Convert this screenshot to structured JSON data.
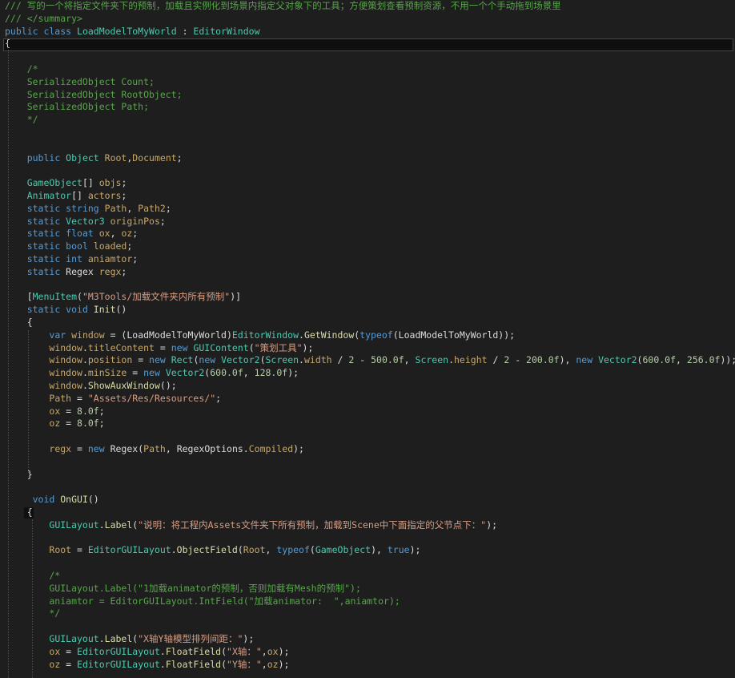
{
  "editor": {
    "colors": {
      "background": "#1e1e1e",
      "comment": "#57a64a",
      "keyword": "#569cd6",
      "type": "#4ec9b0",
      "string": "#d69d85",
      "number": "#b5cea8",
      "identifier": "#dcdcdc",
      "field": "#c8a86b",
      "method": "#dcdcaa"
    },
    "lines": [
      [
        [
          "comment",
          "/// 写的一个将指定文件夹下的预制，加载且实例化到场景内指定父对象下的工具；方便策划查看预制资源，不用一个个手动拖到场景里"
        ]
      ],
      [
        [
          "comment",
          "/// </summary>"
        ]
      ],
      [
        [
          "keyword",
          "public class "
        ],
        [
          "type",
          "LoadModelToMyWorld"
        ],
        [
          "punct",
          " : "
        ],
        [
          "type",
          "EditorWindow"
        ]
      ],
      [
        [
          "punct",
          "{"
        ]
      ],
      [],
      [
        [
          "comment",
          "    /*"
        ]
      ],
      [
        [
          "comment",
          "    SerializedObject Count;"
        ]
      ],
      [
        [
          "comment",
          "    SerializedObject RootObject;"
        ]
      ],
      [
        [
          "comment",
          "    SerializedObject Path;"
        ]
      ],
      [
        [
          "comment",
          "    */"
        ]
      ],
      [],
      [],
      [
        [
          "punct",
          "    "
        ],
        [
          "keyword",
          "public "
        ],
        [
          "type",
          "Object "
        ],
        [
          "field",
          "Root"
        ],
        [
          "punct",
          ","
        ],
        [
          "field",
          "Document"
        ],
        [
          "punct",
          ";"
        ]
      ],
      [],
      [
        [
          "punct",
          "    "
        ],
        [
          "type",
          "GameObject"
        ],
        [
          "punct",
          "[] "
        ],
        [
          "field",
          "objs"
        ],
        [
          "punct",
          ";"
        ]
      ],
      [
        [
          "punct",
          "    "
        ],
        [
          "type",
          "Animator"
        ],
        [
          "punct",
          "[] "
        ],
        [
          "field",
          "actors"
        ],
        [
          "punct",
          ";"
        ]
      ],
      [
        [
          "punct",
          "    "
        ],
        [
          "keyword",
          "static string "
        ],
        [
          "field",
          "Path"
        ],
        [
          "punct",
          ", "
        ],
        [
          "field",
          "Path2"
        ],
        [
          "punct",
          ";"
        ]
      ],
      [
        [
          "punct",
          "    "
        ],
        [
          "keyword",
          "static "
        ],
        [
          "type",
          "Vector3 "
        ],
        [
          "field",
          "originPos"
        ],
        [
          "punct",
          ";"
        ]
      ],
      [
        [
          "punct",
          "    "
        ],
        [
          "keyword",
          "static float "
        ],
        [
          "field",
          "ox"
        ],
        [
          "punct",
          ", "
        ],
        [
          "field",
          "oz"
        ],
        [
          "punct",
          ";"
        ]
      ],
      [
        [
          "punct",
          "    "
        ],
        [
          "keyword",
          "static bool "
        ],
        [
          "field",
          "loaded"
        ],
        [
          "punct",
          ";"
        ]
      ],
      [
        [
          "punct",
          "    "
        ],
        [
          "keyword",
          "static int "
        ],
        [
          "field",
          "aniamtor"
        ],
        [
          "punct",
          ";"
        ]
      ],
      [
        [
          "punct",
          "    "
        ],
        [
          "keyword",
          "static "
        ],
        [
          "ident",
          "Regex "
        ],
        [
          "field",
          "regx"
        ],
        [
          "punct",
          ";"
        ]
      ],
      [],
      [
        [
          "punct",
          "    ["
        ],
        [
          "type",
          "MenuItem"
        ],
        [
          "punct",
          "("
        ],
        [
          "string",
          "\"M3Tools/加载文件夹内所有预制\""
        ],
        [
          "punct",
          ")]"
        ]
      ],
      [
        [
          "punct",
          "    "
        ],
        [
          "keyword",
          "static void "
        ],
        [
          "method",
          "Init"
        ],
        [
          "punct",
          "()"
        ]
      ],
      [
        [
          "punct",
          "    {"
        ]
      ],
      [
        [
          "punct",
          "        "
        ],
        [
          "keyword",
          "var "
        ],
        [
          "field",
          "window"
        ],
        [
          "punct",
          " = ("
        ],
        [
          "ident",
          "LoadModelToMyWorld"
        ],
        [
          "punct",
          ")"
        ],
        [
          "type",
          "EditorWindow"
        ],
        [
          "punct",
          "."
        ],
        [
          "method",
          "GetWindow"
        ],
        [
          "punct",
          "("
        ],
        [
          "keyword",
          "typeof"
        ],
        [
          "punct",
          "("
        ],
        [
          "ident",
          "LoadModelToMyWorld"
        ],
        [
          "punct",
          "));"
        ]
      ],
      [
        [
          "punct",
          "        "
        ],
        [
          "field",
          "window"
        ],
        [
          "punct",
          "."
        ],
        [
          "field",
          "titleContent"
        ],
        [
          "punct",
          " = "
        ],
        [
          "keyword",
          "new "
        ],
        [
          "type",
          "GUIContent"
        ],
        [
          "punct",
          "("
        ],
        [
          "string",
          "\"策划工具\""
        ],
        [
          "punct",
          ");"
        ]
      ],
      [
        [
          "punct",
          "        "
        ],
        [
          "field",
          "window"
        ],
        [
          "punct",
          "."
        ],
        [
          "field",
          "position"
        ],
        [
          "punct",
          " = "
        ],
        [
          "keyword",
          "new "
        ],
        [
          "type",
          "Rect"
        ],
        [
          "punct",
          "("
        ],
        [
          "keyword",
          "new "
        ],
        [
          "type",
          "Vector2"
        ],
        [
          "punct",
          "("
        ],
        [
          "type",
          "Screen"
        ],
        [
          "punct",
          "."
        ],
        [
          "field",
          "width"
        ],
        [
          "punct",
          " / "
        ],
        [
          "number",
          "2"
        ],
        [
          "punct",
          " - "
        ],
        [
          "number",
          "500.0f"
        ],
        [
          "punct",
          ", "
        ],
        [
          "type",
          "Screen"
        ],
        [
          "punct",
          "."
        ],
        [
          "field",
          "height"
        ],
        [
          "punct",
          " / "
        ],
        [
          "number",
          "2"
        ],
        [
          "punct",
          " - "
        ],
        [
          "number",
          "200.0f"
        ],
        [
          "punct",
          "), "
        ],
        [
          "keyword",
          "new "
        ],
        [
          "type",
          "Vector2"
        ],
        [
          "punct",
          "("
        ],
        [
          "number",
          "600.0f"
        ],
        [
          "punct",
          ", "
        ],
        [
          "number",
          "256.0f"
        ],
        [
          "punct",
          "));"
        ]
      ],
      [
        [
          "punct",
          "        "
        ],
        [
          "field",
          "window"
        ],
        [
          "punct",
          "."
        ],
        [
          "field",
          "minSize"
        ],
        [
          "punct",
          " = "
        ],
        [
          "keyword",
          "new "
        ],
        [
          "type",
          "Vector2"
        ],
        [
          "punct",
          "("
        ],
        [
          "number",
          "600.0f"
        ],
        [
          "punct",
          ", "
        ],
        [
          "number",
          "128.0f"
        ],
        [
          "punct",
          ");"
        ]
      ],
      [
        [
          "punct",
          "        "
        ],
        [
          "field",
          "window"
        ],
        [
          "punct",
          "."
        ],
        [
          "method",
          "ShowAuxWindow"
        ],
        [
          "punct",
          "();"
        ]
      ],
      [
        [
          "punct",
          "        "
        ],
        [
          "field",
          "Path"
        ],
        [
          "punct",
          " = "
        ],
        [
          "string",
          "\"Assets/Res/Resources/\""
        ],
        [
          "punct",
          ";"
        ]
      ],
      [
        [
          "punct",
          "        "
        ],
        [
          "field",
          "ox"
        ],
        [
          "punct",
          " = "
        ],
        [
          "number",
          "8.0f"
        ],
        [
          "punct",
          ";"
        ]
      ],
      [
        [
          "punct",
          "        "
        ],
        [
          "field",
          "oz"
        ],
        [
          "punct",
          " = "
        ],
        [
          "number",
          "8.0f"
        ],
        [
          "punct",
          ";"
        ]
      ],
      [],
      [
        [
          "punct",
          "        "
        ],
        [
          "field",
          "regx"
        ],
        [
          "punct",
          " = "
        ],
        [
          "keyword",
          "new "
        ],
        [
          "ident",
          "Regex"
        ],
        [
          "punct",
          "("
        ],
        [
          "field",
          "Path"
        ],
        [
          "punct",
          ", "
        ],
        [
          "ident",
          "RegexOptions"
        ],
        [
          "punct",
          "."
        ],
        [
          "field",
          "Compiled"
        ],
        [
          "punct",
          ");"
        ]
      ],
      [],
      [
        [
          "punct",
          "    }"
        ]
      ],
      [],
      [
        [
          "punct",
          "     "
        ],
        [
          "keyword",
          "void "
        ],
        [
          "method",
          "OnGUI"
        ],
        [
          "punct",
          "()"
        ]
      ],
      [
        [
          "punct",
          "    {"
        ]
      ],
      [
        [
          "punct",
          "        "
        ],
        [
          "type",
          "GUILayout"
        ],
        [
          "punct",
          "."
        ],
        [
          "method",
          "Label"
        ],
        [
          "punct",
          "("
        ],
        [
          "string",
          "\"说明：将工程内Assets文件夹下所有预制，加载到Scene中下面指定的父节点下：\""
        ],
        [
          "punct",
          ");"
        ]
      ],
      [],
      [
        [
          "punct",
          "        "
        ],
        [
          "field",
          "Root"
        ],
        [
          "punct",
          " = "
        ],
        [
          "type",
          "EditorGUILayout"
        ],
        [
          "punct",
          "."
        ],
        [
          "method",
          "ObjectField"
        ],
        [
          "punct",
          "("
        ],
        [
          "field",
          "Root"
        ],
        [
          "punct",
          ", "
        ],
        [
          "keyword",
          "typeof"
        ],
        [
          "punct",
          "("
        ],
        [
          "type",
          "GameObject"
        ],
        [
          "punct",
          "), "
        ],
        [
          "keyword",
          "true"
        ],
        [
          "punct",
          ");"
        ]
      ],
      [],
      [
        [
          "comment",
          "        /*"
        ]
      ],
      [
        [
          "comment",
          "        GUILayout.Label(\"1加载animator的预制，否则加载有Mesh的预制\");"
        ]
      ],
      [
        [
          "comment",
          "        aniamtor = EditorGUILayout.IntField(\"加载animator:  \",aniamtor);"
        ]
      ],
      [
        [
          "comment",
          "        */"
        ]
      ],
      [],
      [
        [
          "punct",
          "        "
        ],
        [
          "type",
          "GUILayout"
        ],
        [
          "punct",
          "."
        ],
        [
          "method",
          "Label"
        ],
        [
          "punct",
          "("
        ],
        [
          "string",
          "\"X轴Y轴模型排列间距：\""
        ],
        [
          "punct",
          ");"
        ]
      ],
      [
        [
          "punct",
          "        "
        ],
        [
          "field",
          "ox"
        ],
        [
          "punct",
          " = "
        ],
        [
          "type",
          "EditorGUILayout"
        ],
        [
          "punct",
          "."
        ],
        [
          "method",
          "FloatField"
        ],
        [
          "punct",
          "("
        ],
        [
          "string",
          "\"X轴：\""
        ],
        [
          "punct",
          ","
        ],
        [
          "field",
          "ox"
        ],
        [
          "punct",
          ");"
        ]
      ],
      [
        [
          "punct",
          "        "
        ],
        [
          "field",
          "oz"
        ],
        [
          "punct",
          " = "
        ],
        [
          "type",
          "EditorGUILayout"
        ],
        [
          "punct",
          "."
        ],
        [
          "method",
          "FloatField"
        ],
        [
          "punct",
          "("
        ],
        [
          "string",
          "\"Y轴：\""
        ],
        [
          "punct",
          ","
        ],
        [
          "field",
          "oz"
        ],
        [
          "punct",
          ");"
        ]
      ]
    ]
  }
}
